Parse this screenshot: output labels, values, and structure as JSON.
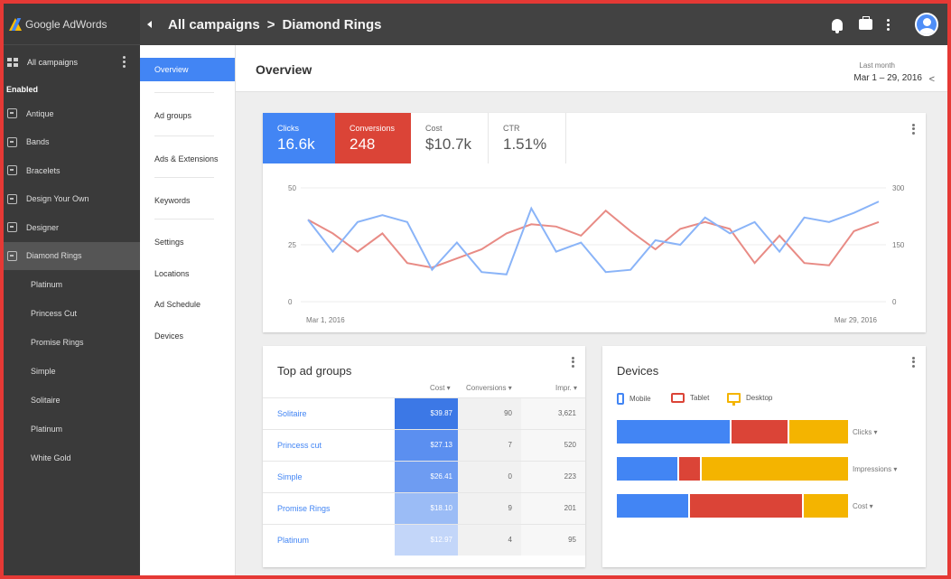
{
  "app": {
    "name": "Google AdWords"
  },
  "sidebar": {
    "all_campaigns_label": "All campaigns",
    "section_label": "Enabled",
    "campaigns": [
      "Antique",
      "Bands",
      "Bracelets",
      "Design Your Own",
      "Designer",
      "Diamond Rings"
    ],
    "active_campaign": "Diamond Rings",
    "sub_items": [
      "Platinum",
      "Princess Cut",
      "Promise Rings",
      "Simple",
      "Solitaire",
      "Platinum",
      "White Gold"
    ]
  },
  "breadcrumb": {
    "parent": "All campaigns",
    "separator": ">",
    "current": "Diamond Rings"
  },
  "subnav": {
    "items": [
      "Overview",
      "Ad groups",
      "Ads & Extensions",
      "Keywords",
      "Settings",
      "Locations",
      "Ad Schedule",
      "Devices"
    ],
    "active": "Overview"
  },
  "overview": {
    "title": "Overview",
    "range_label": "Last month",
    "range_value": "Mar 1 – 29, 2016",
    "range_arrow": "<"
  },
  "metrics": [
    {
      "label": "Clicks",
      "value": "16.6k",
      "color": "#4285f4"
    },
    {
      "label": "Conversions",
      "value": "248",
      "color": "#db4437"
    },
    {
      "label": "Cost",
      "value": "$10.7k"
    },
    {
      "label": "CTR",
      "value": "1.51%"
    }
  ],
  "chart_data": {
    "type": "line",
    "x_labels": [
      "Mar 1, 2016",
      "Mar 29, 2016"
    ],
    "y_left_ticks": [
      "50",
      "25",
      "0"
    ],
    "y_right_ticks": [
      "300",
      "150",
      "0"
    ],
    "ylim_left": [
      0,
      50
    ],
    "ylim_right": [
      0,
      300
    ],
    "grid": true,
    "series": [
      {
        "color": "#8ab4f8",
        "values": [
          36,
          22,
          35,
          38,
          35,
          14,
          26,
          13,
          12,
          41,
          22,
          26,
          13,
          14,
          27,
          25,
          37,
          30,
          35,
          22,
          37,
          35,
          39,
          44
        ]
      },
      {
        "color": "#e88b85",
        "values": [
          36,
          30,
          22,
          30,
          17,
          15,
          19,
          23,
          30,
          34,
          33,
          29,
          40,
          31,
          23,
          32,
          35,
          32,
          17,
          29,
          17,
          16,
          31,
          35
        ]
      }
    ]
  },
  "top_ad_groups": {
    "title": "Top ad groups",
    "headers": {
      "cost": "Cost ▾",
      "conversions": "Conversions ▾",
      "impr": "Impr. ▾"
    },
    "rows": [
      {
        "name": "Solitaire",
        "cost": "$39.87",
        "conversions": "90",
        "impr": "3,621",
        "shade": "#3c78e6"
      },
      {
        "name": "Princess cut",
        "cost": "$27.13",
        "conversions": "7",
        "impr": "520",
        "shade": "#5b8ff0"
      },
      {
        "name": "Simple",
        "cost": "$26.41",
        "conversions": "0",
        "impr": "223",
        "shade": "#6e9cf2"
      },
      {
        "name": "Promise Rings",
        "cost": "$18.10",
        "conversions": "9",
        "impr": "201",
        "shade": "#9bbcf6"
      },
      {
        "name": "Platinum",
        "cost": "$12.97",
        "conversions": "4",
        "impr": "95",
        "shade": "#c3d6f9"
      }
    ]
  },
  "devices": {
    "title": "Devices",
    "legend": [
      {
        "label": "Mobile",
        "color": "#4285f4"
      },
      {
        "label": "Tablet",
        "color": "#db4437"
      },
      {
        "label": "Desktop",
        "color": "#f4b400"
      }
    ],
    "bars": [
      {
        "label": "Clicks ▾",
        "shares": [
          0.49,
          0.25,
          0.26
        ]
      },
      {
        "label": "Impressions ▾",
        "shares": [
          0.26,
          0.1,
          0.64
        ]
      },
      {
        "label": "Cost ▾",
        "shares": [
          0.31,
          0.49,
          0.2
        ]
      }
    ]
  }
}
